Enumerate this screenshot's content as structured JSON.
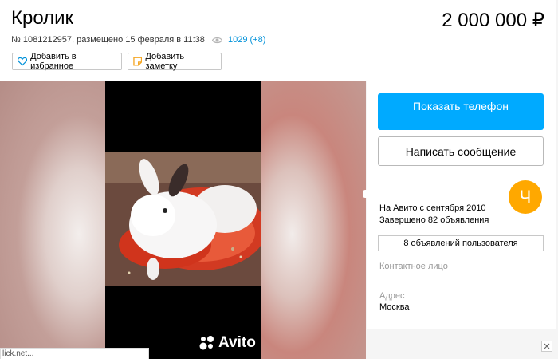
{
  "listing": {
    "title": "Кролик",
    "price": "2 000 000 ₽",
    "meta_prefix": "№ 1081212957, размещено 15 февраля в 11:38",
    "views": "1029 (+8)"
  },
  "actions": {
    "favorite_label": "Добавить в избранное",
    "note_label": "Добавить заметку"
  },
  "gallery": {
    "watermark": "Avito"
  },
  "seller": {
    "phone_button": "Показать телефон",
    "message_button": "Написать сообщение",
    "avatar_letter": "Ч",
    "since": "На Авито с сентября 2010",
    "completed": "Завершено 82 объявления",
    "user_ads_button": "8 объявлений пользователя",
    "contact_label": "Контактное лицо",
    "address_label": "Адрес",
    "address_value": "Москва"
  },
  "status_bar": {
    "text": "lick.net..."
  },
  "colors": {
    "accent": "#00aaff",
    "avatar": "#ffa800",
    "link": "#0091d9"
  },
  "icons": [
    "heart-icon",
    "note-icon",
    "eye-icon",
    "avito-logo-icon",
    "close-icon"
  ]
}
